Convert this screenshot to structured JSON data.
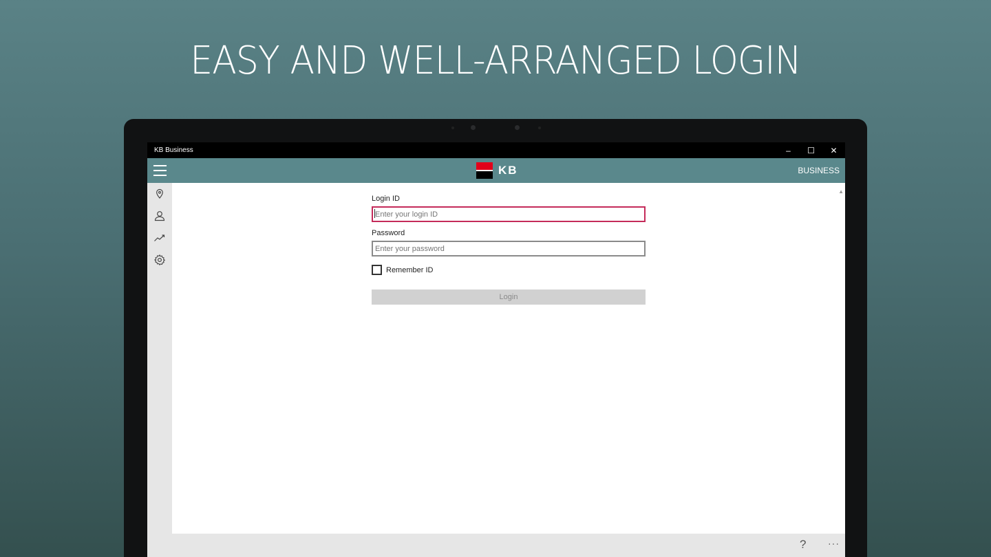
{
  "headline": "EASY AND WELL-ARRANGED LOGIN",
  "window": {
    "title": "KB Business",
    "minimize_glyph": "‒",
    "maximize_glyph": "☐",
    "close_glyph": "✕"
  },
  "header": {
    "logo_text": "KB",
    "right_label": "BUSINESS",
    "brand_colors": {
      "red": "#e2001a",
      "black": "#000000",
      "header_bg": "#5a888c"
    }
  },
  "sidebar": {
    "items": [
      {
        "icon": "location-pin-icon"
      },
      {
        "icon": "user-icon"
      },
      {
        "icon": "trend-chart-icon"
      },
      {
        "icon": "gear-icon"
      }
    ]
  },
  "form": {
    "login_label": "Login ID",
    "login_value": "",
    "login_placeholder": "Enter your login ID",
    "password_label": "Password",
    "password_value": "",
    "password_placeholder": "Enter your password",
    "remember_label": "Remember ID",
    "remember_checked": false,
    "login_button": "Login",
    "focus_color": "#c42a59"
  },
  "appbar": {
    "help_glyph": "?",
    "more_glyph": "···"
  }
}
